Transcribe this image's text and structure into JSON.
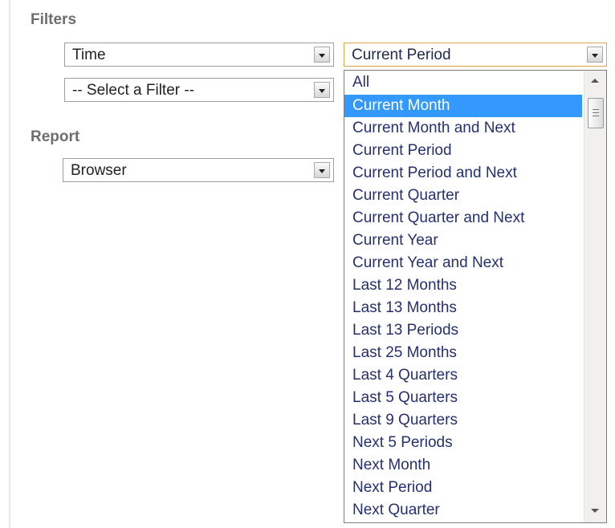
{
  "filters": {
    "heading": "Filters",
    "row1": {
      "field": "Time",
      "value": "Current Period"
    },
    "row2": {
      "field": "-- Select a Filter --"
    }
  },
  "report": {
    "heading": "Report",
    "value": "Browser"
  },
  "dropdown": {
    "selected_index": 1,
    "options": [
      "All",
      "Current Month",
      "Current Month and Next",
      "Current Period",
      "Current Period and Next",
      "Current Quarter",
      "Current Quarter and Next",
      "Current Year",
      "Current Year and Next",
      "Last 12 Months",
      "Last 13 Months",
      "Last 13 Periods",
      "Last 25 Months",
      "Last 4 Quarters",
      "Last 5 Quarters",
      "Last 9 Quarters",
      "Next 5 Periods",
      "Next Month",
      "Next Period",
      "Next Quarter"
    ]
  },
  "colors": {
    "highlight": "#3399ff",
    "option_text": "#253070",
    "focus_border": "#e0a44a",
    "label_text": "#6e6e6e"
  },
  "icons": {
    "dropdown_arrow": "chevron-down-icon",
    "scroll_up": "scroll-up-icon",
    "scroll_down": "scroll-down-icon"
  }
}
